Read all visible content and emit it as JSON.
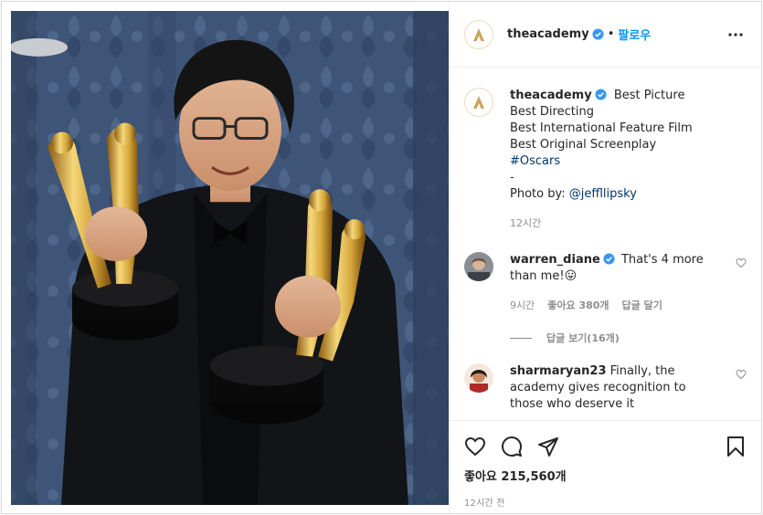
{
  "post": {
    "image_alt": "Bong Joon-ho holding four Oscar statuettes"
  },
  "header": {
    "username": "theacademy",
    "separator": "•",
    "follow_label": "팔로우",
    "more_icon": "more-horizontal-icon"
  },
  "caption": {
    "username": "theacademy",
    "lines": [
      "Best Picture",
      "Best Directing",
      "Best International Feature Film",
      "Best Original Screenplay",
      "#Oscars",
      "-",
      "Photo by: "
    ],
    "mention": "@jeffllipsky",
    "time": "12시간"
  },
  "comments": [
    {
      "username": "warren_diane",
      "verified": true,
      "text_1": "That's 4 more",
      "text_2": "than me!",
      "emoji": "😛",
      "time": "9시간",
      "likes": "좋아요 380개",
      "reply": "답글 달기",
      "view_replies": "답글 보기(16개)"
    },
    {
      "username": "sharmaryan23",
      "verified": false,
      "text_1": "Finally, the",
      "text_2": "academy gives recognition to",
      "text_3": "those who deserve it"
    }
  ],
  "actions": {
    "likes": "좋아요 215,560개",
    "timestamp": "12시간 전"
  },
  "colors": {
    "brand_gold": "#c9a55b",
    "link_blue": "#0095f6",
    "hashtag": "#00376b",
    "verified_blue": "#3897f0"
  }
}
